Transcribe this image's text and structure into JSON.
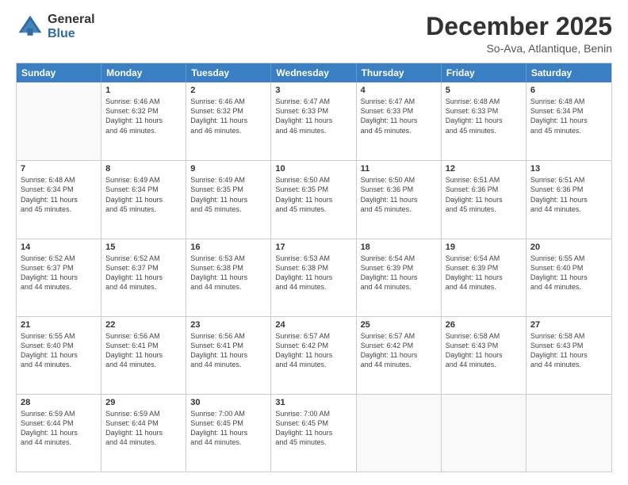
{
  "header": {
    "logo_general": "General",
    "logo_blue": "Blue",
    "month": "December 2025",
    "location": "So-Ava, Atlantique, Benin"
  },
  "days_of_week": [
    "Sunday",
    "Monday",
    "Tuesday",
    "Wednesday",
    "Thursday",
    "Friday",
    "Saturday"
  ],
  "weeks": [
    [
      {
        "day": "",
        "sunrise": "",
        "sunset": "",
        "daylight": ""
      },
      {
        "day": "1",
        "sunrise": "Sunrise: 6:46 AM",
        "sunset": "Sunset: 6:32 PM",
        "daylight": "Daylight: 11 hours and 46 minutes."
      },
      {
        "day": "2",
        "sunrise": "Sunrise: 6:46 AM",
        "sunset": "Sunset: 6:32 PM",
        "daylight": "Daylight: 11 hours and 46 minutes."
      },
      {
        "day": "3",
        "sunrise": "Sunrise: 6:47 AM",
        "sunset": "Sunset: 6:33 PM",
        "daylight": "Daylight: 11 hours and 46 minutes."
      },
      {
        "day": "4",
        "sunrise": "Sunrise: 6:47 AM",
        "sunset": "Sunset: 6:33 PM",
        "daylight": "Daylight: 11 hours and 45 minutes."
      },
      {
        "day": "5",
        "sunrise": "Sunrise: 6:48 AM",
        "sunset": "Sunset: 6:33 PM",
        "daylight": "Daylight: 11 hours and 45 minutes."
      },
      {
        "day": "6",
        "sunrise": "Sunrise: 6:48 AM",
        "sunset": "Sunset: 6:34 PM",
        "daylight": "Daylight: 11 hours and 45 minutes."
      }
    ],
    [
      {
        "day": "7",
        "sunrise": "Sunrise: 6:48 AM",
        "sunset": "Sunset: 6:34 PM",
        "daylight": "Daylight: 11 hours and 45 minutes."
      },
      {
        "day": "8",
        "sunrise": "Sunrise: 6:49 AM",
        "sunset": "Sunset: 6:34 PM",
        "daylight": "Daylight: 11 hours and 45 minutes."
      },
      {
        "day": "9",
        "sunrise": "Sunrise: 6:49 AM",
        "sunset": "Sunset: 6:35 PM",
        "daylight": "Daylight: 11 hours and 45 minutes."
      },
      {
        "day": "10",
        "sunrise": "Sunrise: 6:50 AM",
        "sunset": "Sunset: 6:35 PM",
        "daylight": "Daylight: 11 hours and 45 minutes."
      },
      {
        "day": "11",
        "sunrise": "Sunrise: 6:50 AM",
        "sunset": "Sunset: 6:36 PM",
        "daylight": "Daylight: 11 hours and 45 minutes."
      },
      {
        "day": "12",
        "sunrise": "Sunrise: 6:51 AM",
        "sunset": "Sunset: 6:36 PM",
        "daylight": "Daylight: 11 hours and 45 minutes."
      },
      {
        "day": "13",
        "sunrise": "Sunrise: 6:51 AM",
        "sunset": "Sunset: 6:36 PM",
        "daylight": "Daylight: 11 hours and 44 minutes."
      }
    ],
    [
      {
        "day": "14",
        "sunrise": "Sunrise: 6:52 AM",
        "sunset": "Sunset: 6:37 PM",
        "daylight": "Daylight: 11 hours and 44 minutes."
      },
      {
        "day": "15",
        "sunrise": "Sunrise: 6:52 AM",
        "sunset": "Sunset: 6:37 PM",
        "daylight": "Daylight: 11 hours and 44 minutes."
      },
      {
        "day": "16",
        "sunrise": "Sunrise: 6:53 AM",
        "sunset": "Sunset: 6:38 PM",
        "daylight": "Daylight: 11 hours and 44 minutes."
      },
      {
        "day": "17",
        "sunrise": "Sunrise: 6:53 AM",
        "sunset": "Sunset: 6:38 PM",
        "daylight": "Daylight: 11 hours and 44 minutes."
      },
      {
        "day": "18",
        "sunrise": "Sunrise: 6:54 AM",
        "sunset": "Sunset: 6:39 PM",
        "daylight": "Daylight: 11 hours and 44 minutes."
      },
      {
        "day": "19",
        "sunrise": "Sunrise: 6:54 AM",
        "sunset": "Sunset: 6:39 PM",
        "daylight": "Daylight: 11 hours and 44 minutes."
      },
      {
        "day": "20",
        "sunrise": "Sunrise: 6:55 AM",
        "sunset": "Sunset: 6:40 PM",
        "daylight": "Daylight: 11 hours and 44 minutes."
      }
    ],
    [
      {
        "day": "21",
        "sunrise": "Sunrise: 6:55 AM",
        "sunset": "Sunset: 6:40 PM",
        "daylight": "Daylight: 11 hours and 44 minutes."
      },
      {
        "day": "22",
        "sunrise": "Sunrise: 6:56 AM",
        "sunset": "Sunset: 6:41 PM",
        "daylight": "Daylight: 11 hours and 44 minutes."
      },
      {
        "day": "23",
        "sunrise": "Sunrise: 6:56 AM",
        "sunset": "Sunset: 6:41 PM",
        "daylight": "Daylight: 11 hours and 44 minutes."
      },
      {
        "day": "24",
        "sunrise": "Sunrise: 6:57 AM",
        "sunset": "Sunset: 6:42 PM",
        "daylight": "Daylight: 11 hours and 44 minutes."
      },
      {
        "day": "25",
        "sunrise": "Sunrise: 6:57 AM",
        "sunset": "Sunset: 6:42 PM",
        "daylight": "Daylight: 11 hours and 44 minutes."
      },
      {
        "day": "26",
        "sunrise": "Sunrise: 6:58 AM",
        "sunset": "Sunset: 6:43 PM",
        "daylight": "Daylight: 11 hours and 44 minutes."
      },
      {
        "day": "27",
        "sunrise": "Sunrise: 6:58 AM",
        "sunset": "Sunset: 6:43 PM",
        "daylight": "Daylight: 11 hours and 44 minutes."
      }
    ],
    [
      {
        "day": "28",
        "sunrise": "Sunrise: 6:59 AM",
        "sunset": "Sunset: 6:44 PM",
        "daylight": "Daylight: 11 hours and 44 minutes."
      },
      {
        "day": "29",
        "sunrise": "Sunrise: 6:59 AM",
        "sunset": "Sunset: 6:44 PM",
        "daylight": "Daylight: 11 hours and 44 minutes."
      },
      {
        "day": "30",
        "sunrise": "Sunrise: 7:00 AM",
        "sunset": "Sunset: 6:45 PM",
        "daylight": "Daylight: 11 hours and 44 minutes."
      },
      {
        "day": "31",
        "sunrise": "Sunrise: 7:00 AM",
        "sunset": "Sunset: 6:45 PM",
        "daylight": "Daylight: 11 hours and 45 minutes."
      },
      {
        "day": "",
        "sunrise": "",
        "sunset": "",
        "daylight": ""
      },
      {
        "day": "",
        "sunrise": "",
        "sunset": "",
        "daylight": ""
      },
      {
        "day": "",
        "sunrise": "",
        "sunset": "",
        "daylight": ""
      }
    ]
  ]
}
